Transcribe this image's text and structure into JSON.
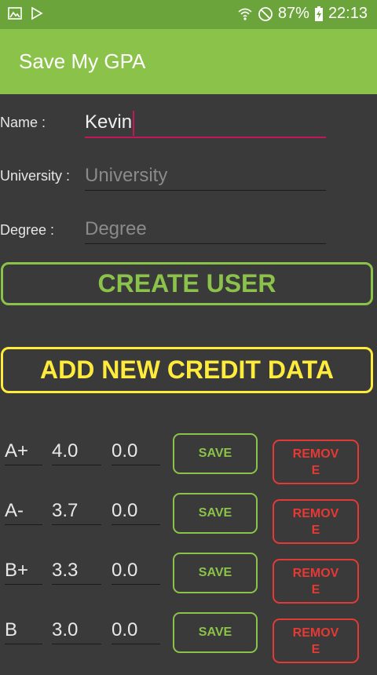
{
  "status_bar": {
    "battery": "87%",
    "time": "22:13"
  },
  "app_bar": {
    "title": "Save My GPA"
  },
  "form": {
    "name": {
      "label": "Name :",
      "value": "Kevin"
    },
    "university": {
      "label": "University :",
      "placeholder": "University"
    },
    "degree": {
      "label": "Degree :",
      "placeholder": "Degree"
    }
  },
  "buttons": {
    "create_user": "CREATE USER",
    "add_credit": "ADD NEW CREDIT DATA"
  },
  "grade_rows": [
    {
      "grade": "A+",
      "points": "4.0",
      "credits": "0.0",
      "save": "SAVE",
      "remove": "REMOVE"
    },
    {
      "grade": "A-",
      "points": "3.7",
      "credits": "0.0",
      "save": "SAVE",
      "remove": "REMOVE"
    },
    {
      "grade": "B+",
      "points": "3.3",
      "credits": "0.0",
      "save": "SAVE",
      "remove": "REMOVE"
    },
    {
      "grade": "B",
      "points": "3.0",
      "credits": "0.0",
      "save": "SAVE",
      "remove": "REMOVE"
    }
  ],
  "colors": {
    "status_bar": "#6ba43a",
    "app_bar": "#8bc34a",
    "background": "#3a3a3a",
    "create_user": "#8bc34a",
    "add_credit": "#ffeb3b",
    "remove": "#e53935",
    "focus_underline": "#c2185b"
  }
}
